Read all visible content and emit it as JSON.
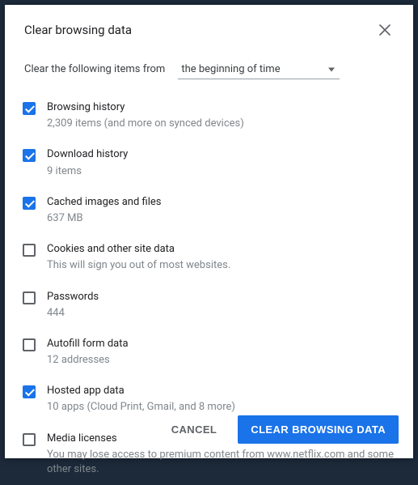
{
  "dialog": {
    "title": "Clear browsing data",
    "clear_from_label": "Clear the following items from",
    "time_range": "the beginning of time",
    "options": [
      {
        "label": "Browsing history",
        "sub": "2,309 items (and more on synced devices)",
        "checked": true
      },
      {
        "label": "Download history",
        "sub": "9 items",
        "checked": true
      },
      {
        "label": "Cached images and files",
        "sub": "637 MB",
        "checked": true
      },
      {
        "label": "Cookies and other site data",
        "sub": "This will sign you out of most websites.",
        "checked": false
      },
      {
        "label": "Passwords",
        "sub": "444",
        "checked": false
      },
      {
        "label": "Autofill form data",
        "sub": "12 addresses",
        "checked": false
      },
      {
        "label": "Hosted app data",
        "sub": "10 apps (Cloud Print, Gmail, and 8 more)",
        "checked": true
      },
      {
        "label": "Media licenses",
        "sub": "You may lose access to premium content from www.netflix.com and some other sites.",
        "checked": false
      }
    ],
    "cancel_label": "CANCEL",
    "action_label": "CLEAR BROWSING DATA"
  }
}
